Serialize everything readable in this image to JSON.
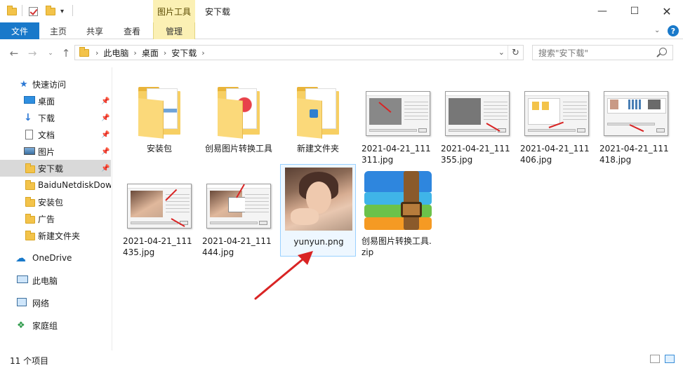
{
  "window": {
    "context_tab_group": "图片工具",
    "title": "安下载"
  },
  "ribbon": {
    "tabs": [
      "文件",
      "主页",
      "共享",
      "查看",
      "管理"
    ]
  },
  "address": {
    "crumbs": [
      "此电脑",
      "桌面",
      "安下载"
    ],
    "search_placeholder": "搜索\"安下载\""
  },
  "sidebar": {
    "quick_access": "快速访问",
    "items": [
      {
        "label": "桌面",
        "icon": "desktop-icon",
        "pinned": true
      },
      {
        "label": "下载",
        "icon": "download-icon",
        "pinned": true
      },
      {
        "label": "文档",
        "icon": "document-icon",
        "pinned": true
      },
      {
        "label": "图片",
        "icon": "picture-icon",
        "pinned": true
      },
      {
        "label": "安下载",
        "icon": "folder-icon",
        "pinned": true
      },
      {
        "label": "BaiduNetdiskDow",
        "icon": "folder-icon",
        "pinned": false
      },
      {
        "label": "安装包",
        "icon": "folder-icon",
        "pinned": false
      },
      {
        "label": "广告",
        "icon": "folder-icon",
        "pinned": false
      },
      {
        "label": "新建文件夹",
        "icon": "folder-icon",
        "pinned": false
      }
    ],
    "onedrive": "OneDrive",
    "this_pc": "此电脑",
    "network": "网络",
    "homegroup": "家庭组"
  },
  "files": [
    {
      "name": "安装包",
      "type": "folder"
    },
    {
      "name": "创易图片转换工具",
      "type": "folder"
    },
    {
      "name": "新建文件夹",
      "type": "folder"
    },
    {
      "name": "2021-04-21_111311.jpg",
      "type": "screenshot"
    },
    {
      "name": "2021-04-21_111355.jpg",
      "type": "screenshot"
    },
    {
      "name": "2021-04-21_111406.jpg",
      "type": "screenshot"
    },
    {
      "name": "2021-04-21_111418.jpg",
      "type": "screenshot"
    },
    {
      "name": "2021-04-21_111435.jpg",
      "type": "screenshot"
    },
    {
      "name": "2021-04-21_111444.jpg",
      "type": "screenshot"
    },
    {
      "name": "yunyun.png",
      "type": "photo",
      "selected": true
    },
    {
      "name": "创易图片转换工具.zip",
      "type": "zip"
    }
  ],
  "status": {
    "item_count": "11 个项目"
  },
  "colors": {
    "accent": "#1979ca",
    "context_tab": "#fbf0b4",
    "selection": "#eef7ff",
    "arrow": "#d92424"
  }
}
